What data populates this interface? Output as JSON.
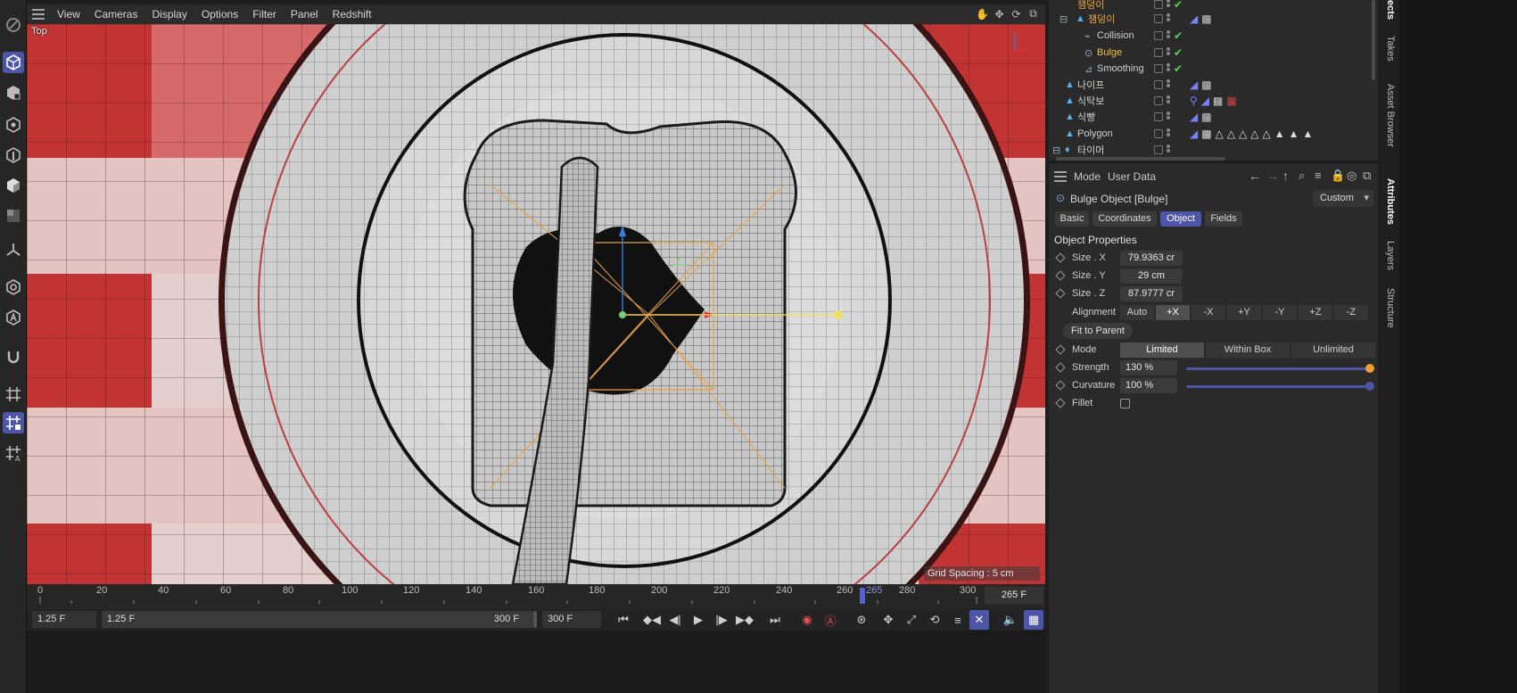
{
  "viewport": {
    "menu": [
      "View",
      "Cameras",
      "Display",
      "Options",
      "Filter",
      "Panel",
      "Redshift"
    ],
    "camera_label": "Top",
    "grid_spacing": "Grid Spacing : 5 cm"
  },
  "timeline": {
    "ticks": [
      "0",
      "20",
      "40",
      "60",
      "80",
      "100",
      "120",
      "140",
      "160",
      "180",
      "200",
      "220",
      "240",
      "260",
      "265",
      "280",
      "300"
    ],
    "current_frame_marker": "265",
    "current_frame_field": "265 F"
  },
  "transport": {
    "start_frame": "1.25 F",
    "range_start": "1.25 F",
    "range_end": "300 F",
    "end_frame": "300 F"
  },
  "object_manager": {
    "rows": [
      {
        "name": "잼덩이",
        "color": "#e8a640"
      },
      {
        "name": "잼덩이",
        "color": "#e8a640"
      },
      {
        "name": "Collision",
        "color": "#d0d0d0"
      },
      {
        "name": "Bulge",
        "color": "#f0c040"
      },
      {
        "name": "Smoothing",
        "color": "#d0d0d0"
      },
      {
        "name": "나이프",
        "color": "#d0d0d0"
      },
      {
        "name": "식탁보",
        "color": "#d0d0d0"
      },
      {
        "name": "식빵",
        "color": "#d0d0d0"
      },
      {
        "name": "Polygon",
        "color": "#d0d0d0"
      },
      {
        "name": "타이머",
        "color": "#d0d0d0"
      }
    ]
  },
  "attributes": {
    "menu_mode": "Mode",
    "menu_userdata": "User Data",
    "object_title": "Bulge Object [Bulge]",
    "preset": "Custom",
    "tabs": [
      "Basic",
      "Coordinates",
      "Object",
      "Fields"
    ],
    "active_tab": "Object",
    "section": "Object Properties",
    "size_x_label": "Size . X",
    "size_x": "79.9363 cr",
    "size_y_label": "Size . Y",
    "size_y": "29 cm",
    "size_z_label": "Size . Z",
    "size_z": "87.9777 cr",
    "alignment_label": "Alignment",
    "alignment_options": [
      "Auto",
      "+X",
      "-X",
      "+Y",
      "-Y",
      "+Z",
      "-Z"
    ],
    "alignment_selected": "+X",
    "fit_to_parent": "Fit to Parent",
    "mode_label": "Mode",
    "mode_options": [
      "Limited",
      "Within Box",
      "Unlimited"
    ],
    "mode_selected": "Limited",
    "strength_label": "Strength",
    "strength": "130 %",
    "strength_fraction": 1.0,
    "curvature_label": "Curvature",
    "curvature": "100 %",
    "curvature_fraction": 1.0,
    "fillet_label": "Fillet",
    "fillet_checked": false,
    "accent": "#4d55a8",
    "knob_orange": "#f0a030"
  },
  "side_tabs": [
    "Takes",
    "Asset Browser",
    "Attributes",
    "Layers",
    "Structure"
  ],
  "side_tab_top": "ects"
}
